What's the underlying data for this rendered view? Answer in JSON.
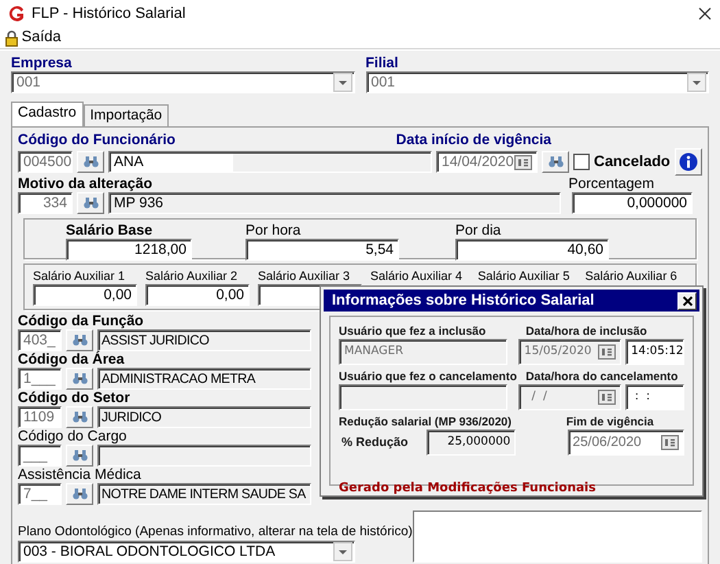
{
  "window": {
    "title": "FLP - Histórico Salarial"
  },
  "menu": [
    {
      "label": "Saída"
    }
  ],
  "empresa": {
    "label": "Empresa",
    "value": "001"
  },
  "filial": {
    "label": "Filial",
    "value": "001"
  },
  "tabs": [
    {
      "label": "Cadastro",
      "selected": true
    },
    {
      "label": "Importação",
      "selected": false
    }
  ],
  "funcionario": {
    "label": "Código do Funcionário",
    "code": "004500",
    "name": "ANA"
  },
  "vigencia": {
    "label": "Data início de vigência",
    "date": "14/04/2020"
  },
  "cancelado": {
    "label": "Cancelado",
    "checked": false
  },
  "motivo": {
    "label": "Motivo da alteração",
    "code": "334",
    "text": "MP 936"
  },
  "porcentagem": {
    "label": "Porcentagem",
    "value": "0,000000"
  },
  "salary": [
    {
      "label": "Salário Base",
      "value": "1218,00",
      "kind": "main"
    },
    {
      "label": "Por hora",
      "value": "5,54",
      "kind": "rate"
    },
    {
      "label": "Por dia",
      "value": "40,60",
      "kind": "rate"
    }
  ],
  "aux": [
    {
      "label": "Salário Auxiliar 1",
      "value": "0,00",
      "kind": "field"
    },
    {
      "label": "Salário Auxiliar 2",
      "value": "0,00",
      "kind": "field"
    },
    {
      "label": "Salário Auxiliar 3",
      "kind": "field"
    },
    {
      "label": "Salário Auxiliar 4",
      "kind": "label"
    },
    {
      "label": "Salário Auxiliar 5",
      "kind": "label"
    },
    {
      "label": "Salário Auxiliar 6",
      "kind": "label"
    }
  ],
  "codes": [
    {
      "label": "Código da Função",
      "code": "403_",
      "text": "ASSIST JURIDICO",
      "kind": "required"
    },
    {
      "label": "Código da Área",
      "code": "1___",
      "text": "ADMINISTRACAO METRA",
      "kind": "required"
    },
    {
      "label": "Código do Setor",
      "code": "1109",
      "text": "JURIDICO",
      "kind": "required"
    },
    {
      "label": "Código do Cargo",
      "code": "___",
      "kind": "optional"
    },
    {
      "label": "Assistência Médica",
      "code": "7__",
      "text": "NOTRE DAME INTERM SAUDE SA",
      "kind": "optional"
    }
  ],
  "plano": {
    "label": "Plano Odontológico (Apenas informativo, alterar na tela de histórico)",
    "value": "003 - BIORAL ODONTOLOGICO LTDA"
  },
  "dialog": {
    "title": "Informações sobre Histórico Salarial",
    "inclusion": {
      "user_label": "Usuário que fez a inclusão",
      "user": "MANAGER",
      "date_label": "Data/hora de inclusão",
      "date": "15/05/2020",
      "time": "14:05:12"
    },
    "cancel": {
      "user_label": "Usuário que fez o cancelamento",
      "date_label": "Data/hora do cancelamento",
      "date": "  /  /",
      "time": " :  :"
    },
    "reduction": {
      "label": "Redução salarial (MP 936/2020)",
      "pct_label": "% Redução",
      "pct": "25,000000",
      "end_label": "Fim de vigência",
      "end": "25/06/2020"
    },
    "note": "Gerado pela Modificações Funcionais"
  }
}
